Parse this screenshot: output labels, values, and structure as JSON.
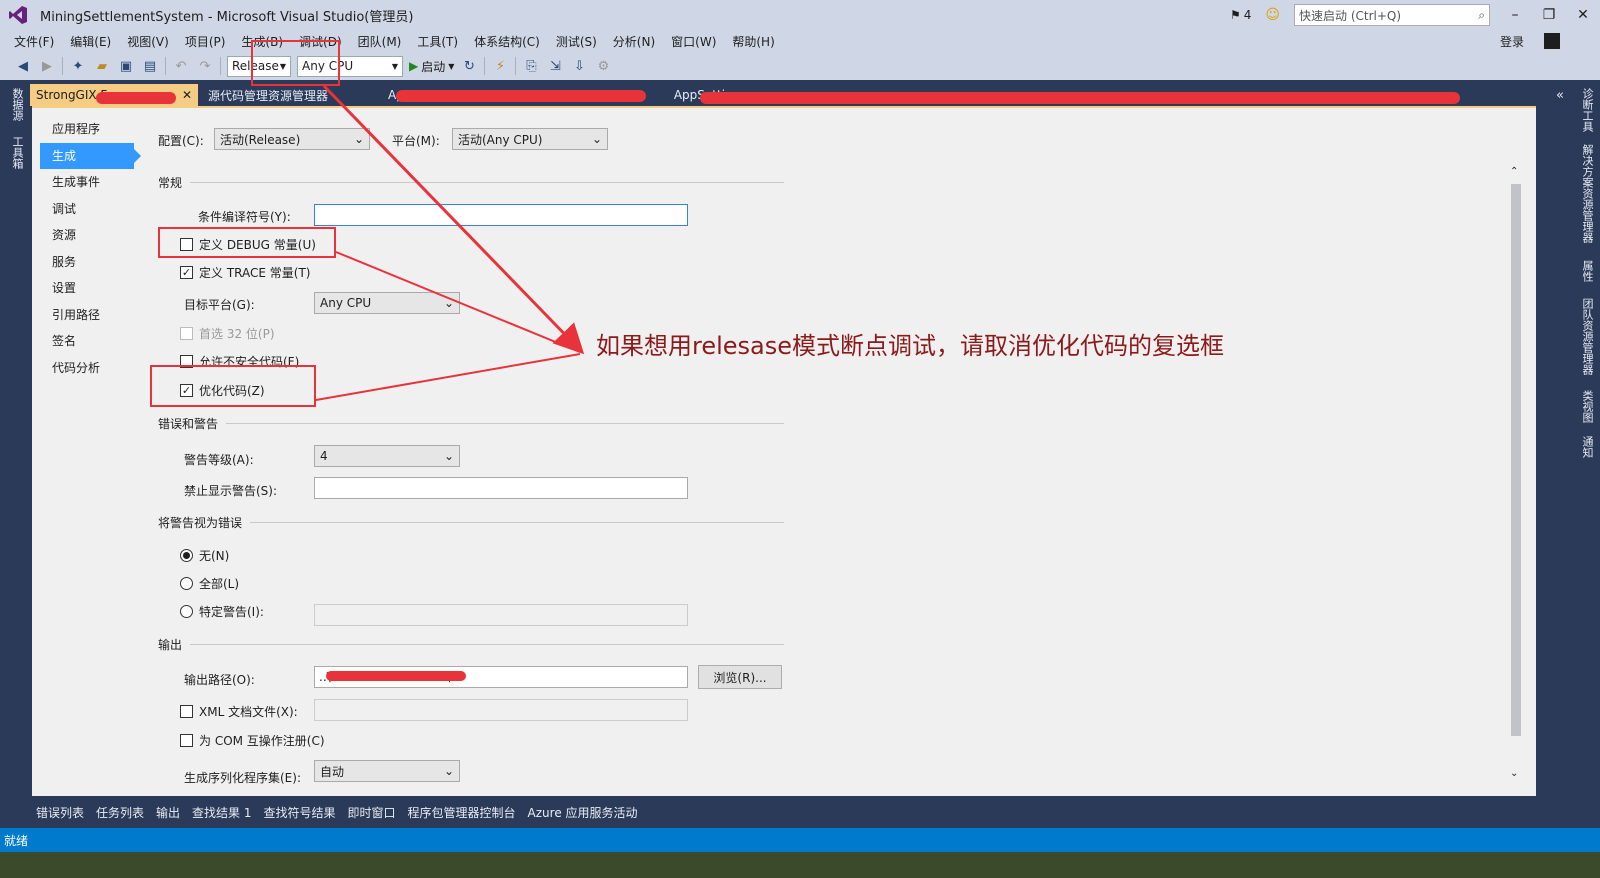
{
  "window": {
    "title": "MiningSettlementSystem - Microsoft Visual Studio(管理员)",
    "notification_count": "4",
    "quick_launch_placeholder": "快速启动 (Ctrl+Q)"
  },
  "menu": {
    "items": [
      "文件(F)",
      "编辑(E)",
      "视图(V)",
      "项目(P)",
      "生成(B)",
      "调试(D)",
      "团队(M)",
      "工具(T)",
      "体系结构(C)",
      "测试(S)",
      "分析(N)",
      "窗口(W)",
      "帮助(H)"
    ],
    "login": "登录"
  },
  "toolbar": {
    "configuration": "Release",
    "platform": "Any CPU",
    "start": "启动"
  },
  "left_tools": [
    "数据源",
    "工具箱"
  ],
  "right_tools": [
    "诊断工具",
    "解决方案资源管理器",
    "属性",
    "团队资源管理器",
    "类视图",
    "通知"
  ],
  "doc_tabs": {
    "active": "StrongGIX Fo... .ap",
    "others": [
      "源代码管理资源管理器",
      "Ap",
      "AppSetti"
    ]
  },
  "nav": {
    "items": [
      "应用程序",
      "生成",
      "生成事件",
      "调试",
      "资源",
      "服务",
      "设置",
      "引用路径",
      "签名",
      "代码分析"
    ],
    "active_index": 1
  },
  "build": {
    "config_label": "配置(C):",
    "config_value": "活动(Release)",
    "platform_label": "平台(M):",
    "platform_value": "活动(Any CPU)",
    "general": {
      "header": "常规",
      "conditional_symbols_label": "条件编译符号(Y):",
      "conditional_symbols_value": "",
      "define_debug": "定义 DEBUG 常量(U)",
      "define_debug_checked": false,
      "define_trace": "定义 TRACE 常量(T)",
      "define_trace_checked": true,
      "target_platform_label": "目标平台(G):",
      "target_platform_value": "Any CPU",
      "prefer32": "首选 32 位(P)",
      "allow_unsafe": "允许不安全代码(F)",
      "optimize": "优化代码(Z)",
      "optimize_checked": true
    },
    "errors": {
      "header": "错误和警告",
      "warning_level_label": "警告等级(A):",
      "warning_level_value": "4",
      "suppress_label": "禁止显示警告(S):",
      "suppress_value": ""
    },
    "treat_warnings": {
      "header": "将警告视为错误",
      "none": "无(N)",
      "all": "全部(L)",
      "specific": "特定警告(I):",
      "selected": "none"
    },
    "output": {
      "header": "输出",
      "path_label": "输出路径(O):",
      "path_value": "..\\S                    lease\\",
      "browse": "浏览(R)...",
      "xml_doc": "XML 文档文件(X):",
      "com_register": "为 COM 互操作注册(C)",
      "serialization_label": "生成序列化程序集(E):",
      "serialization_value": "自动"
    }
  },
  "annotation": "如果想用relesase模式断点调试，请取消优化代码的复选框",
  "bottom_tabs": [
    "错误列表",
    "任务列表",
    "输出",
    "查找结果 1",
    "查找符号结果",
    "即时窗口",
    "程序包管理器控制台",
    "Azure 应用服务活动"
  ],
  "status": "就绪"
}
